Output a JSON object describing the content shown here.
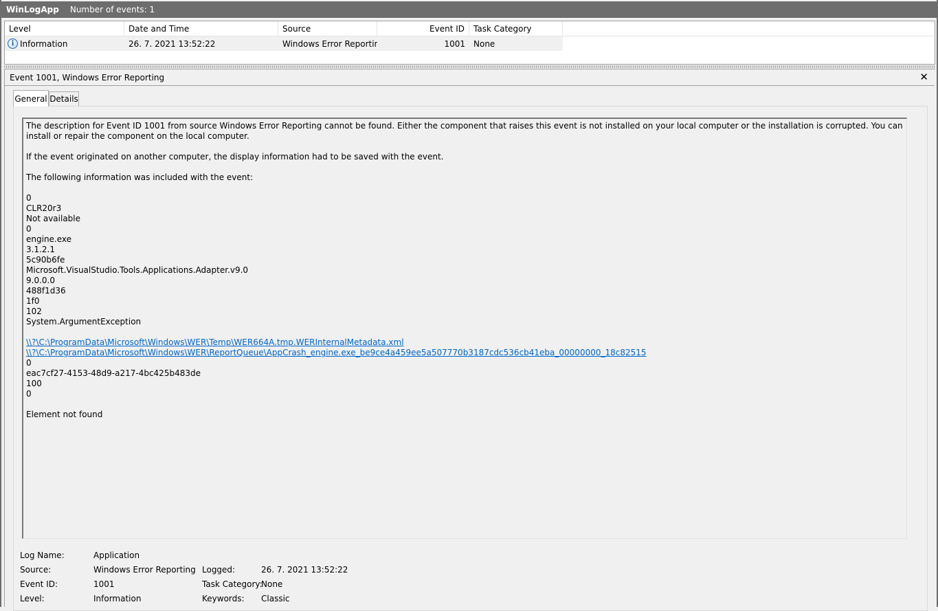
{
  "titlebar": {
    "app_name": "WinLogApp",
    "event_count_label": "Number of events: 1"
  },
  "events_list": {
    "columns": {
      "level": "Level",
      "date_time": "Date and Time",
      "source": "Source",
      "event_id": "Event ID",
      "task_category": "Task Category"
    },
    "rows": [
      {
        "icon": "information-icon",
        "level": "Information",
        "date_time": "26. 7. 2021 13:52:22",
        "source": "Windows Error Reporting",
        "event_id": "1001",
        "task_category": "None"
      }
    ]
  },
  "detail": {
    "title": "Event 1001, Windows Error Reporting",
    "close_label": "✕",
    "tabs": [
      {
        "label": "General",
        "selected": true
      },
      {
        "label": "Details",
        "selected": false
      }
    ],
    "description": {
      "p1": "The description for Event ID 1001 from source Windows Error Reporting cannot be found. Either the component that raises this event is not installed on your local computer or the installation is corrupted. You can install or repair the component on the local computer.",
      "p2": "If the event originated on another computer, the display information had to be saved with the event.",
      "p3": "The following information was included with the event:",
      "values_1": [
        "0",
        "CLR20r3",
        "Not available",
        "0",
        "engine.exe",
        "3.1.2.1",
        "5c90b6fe",
        "Microsoft.VisualStudio.Tools.Applications.Adapter.v9.0",
        "9.0.0.0",
        "488f1d36",
        "1f0",
        "102",
        "System.ArgumentException"
      ],
      "links": [
        "\\\\?\\C:\\ProgramData\\Microsoft\\Windows\\WER\\Temp\\WER664A.tmp.WERInternalMetadata.xml",
        "\\\\?\\C:\\ProgramData\\Microsoft\\Windows\\WER\\ReportQueue\\AppCrash_engine.exe_be9ce4a459ee5a507770b3187cdc536cb41eba_00000000_18c82515"
      ],
      "values_2": [
        "0",
        "eac7cf27-4153-48d9-a217-4bc425b483de",
        "100",
        "0"
      ],
      "footer": "Element not found"
    },
    "properties": {
      "log_name_label": "Log Name:",
      "log_name": "Application",
      "source_label": "Source:",
      "source": "Windows Error Reporting",
      "logged_label": "Logged:",
      "logged": "26. 7. 2021 13:52:22",
      "event_id_label": "Event ID:",
      "event_id": "1001",
      "task_category_label": "Task Category:",
      "task_category": "None",
      "level_label": "Level:",
      "level": "Information",
      "keywords_label": "Keywords:",
      "keywords": "Classic"
    }
  }
}
